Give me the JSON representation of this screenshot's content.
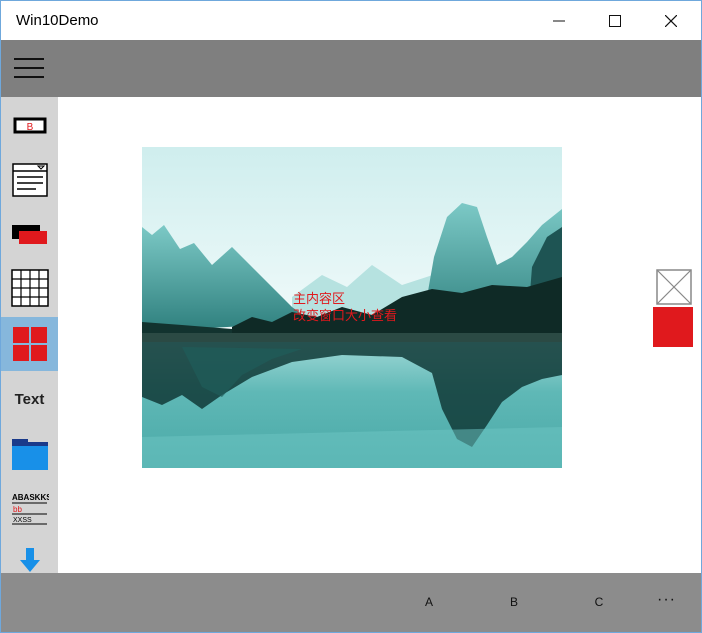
{
  "window": {
    "title": "Win10Demo",
    "minimize_icon": "minimize-icon",
    "maximize_icon": "maximize-icon",
    "close_icon": "close-icon"
  },
  "header": {
    "menu_icon": "hamburger-menu-icon"
  },
  "sidebar": {
    "items": [
      {
        "icon": "button-control-icon",
        "glyph_text": "B"
      },
      {
        "icon": "combobox-control-icon"
      },
      {
        "icon": "overlapping-panels-icon"
      },
      {
        "icon": "grid-control-icon"
      },
      {
        "icon": "tiles-icon",
        "selected": true
      },
      {
        "label": "Text"
      },
      {
        "icon": "folder-icon"
      },
      {
        "icon": "rich-text-icon",
        "lines": [
          "ABASKKS",
          "bb",
          "XXSS"
        ]
      },
      {
        "icon": "download-icon"
      }
    ]
  },
  "content": {
    "image": "landscape-mountains-lake",
    "overlay_line1": "主内容区",
    "overlay_line2": "改变窗口大小查看",
    "side_icons": [
      "broken-image-icon",
      "red-square-icon"
    ]
  },
  "command_bar": {
    "buttons": [
      "A",
      "B",
      "C"
    ],
    "more_label": "···"
  },
  "colors": {
    "header_gray": "#7f7f7f",
    "sidebar_gray": "#d4d4d4",
    "selected_blue": "#86b7dc",
    "accent_red": "#e0191d",
    "command_bar_gray": "#8c8c8c"
  }
}
